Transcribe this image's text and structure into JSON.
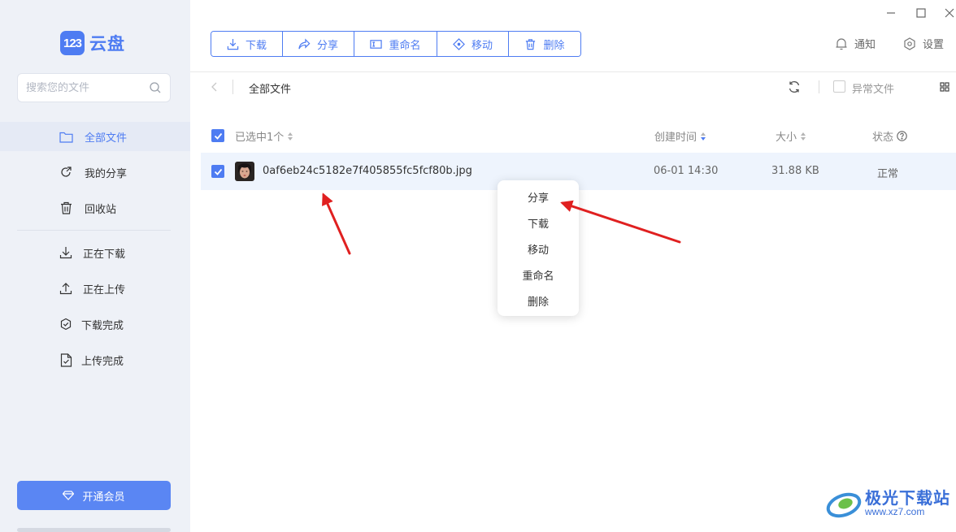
{
  "app": {
    "logo_badge": "123",
    "logo_text": "云盘"
  },
  "search": {
    "placeholder": "搜索您的文件"
  },
  "sidebar": {
    "items": [
      {
        "label": "全部文件",
        "icon": "folder-icon",
        "active": true
      },
      {
        "label": "我的分享",
        "icon": "share-icon"
      },
      {
        "label": "回收站",
        "icon": "trash-icon"
      },
      {
        "label": "正在下载",
        "icon": "download-icon"
      },
      {
        "label": "正在上传",
        "icon": "upload-icon"
      },
      {
        "label": "下载完成",
        "icon": "check-circle-icon"
      },
      {
        "label": "上传完成",
        "icon": "file-check-icon"
      }
    ],
    "vip_label": "开通会员"
  },
  "toolbar": {
    "download": "下载",
    "share": "分享",
    "rename": "重命名",
    "move": "移动",
    "delete": "删除"
  },
  "header": {
    "notify": "通知",
    "settings": "设置"
  },
  "breadcrumb": {
    "current": "全部文件"
  },
  "filter": {
    "abnormal_label": "异常文件"
  },
  "table": {
    "selected_label": "已选中1个",
    "columns": {
      "created": "创建时间",
      "size": "大小",
      "status": "状态"
    },
    "rows": [
      {
        "name": "0af6eb24c5182e7f405855fc5fcf80b.jpg",
        "created": "06-01 14:30",
        "size": "31.88 KB",
        "status": "正常",
        "checked": true
      }
    ]
  },
  "context_menu": {
    "items": [
      "分享",
      "下载",
      "移动",
      "重命名",
      "删除"
    ]
  },
  "watermark": {
    "title": "极光下载站",
    "url": "www.xz7.com"
  },
  "colors": {
    "accent": "#4e7cf2",
    "sidebar_bg": "#eef1f7",
    "row_selected": "#eef4fd",
    "arrow": "#e02020"
  }
}
